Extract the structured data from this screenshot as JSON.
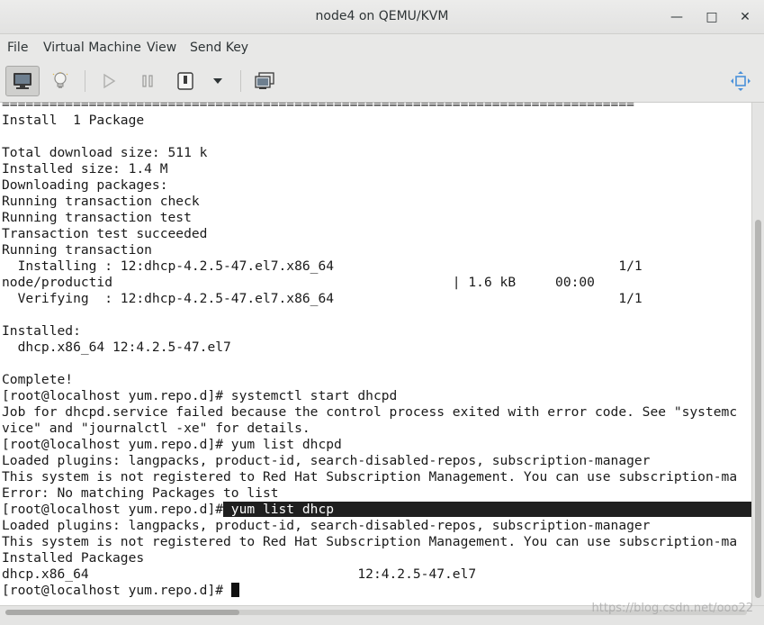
{
  "window": {
    "title": "node4 on QEMU/KVM",
    "minimize_glyph": "—",
    "maximize_glyph": "□",
    "close_glyph": "✕"
  },
  "menu": {
    "items": [
      "File",
      "Virtual Machine",
      "View",
      "Send Key"
    ]
  },
  "toolbar": {
    "buttons": [
      "console-view-icon",
      "details-lightbulb-icon",
      "run-play-icon",
      "pause-icon",
      "shutdown-power-icon",
      "shutdown-dropdown-chevron-icon",
      "snapshot-manager-icon",
      "fullscreen-resize-icon"
    ]
  },
  "console": {
    "lines": [
      "================================================================================",
      "Install  1 Package",
      "",
      "Total download size: 511 k",
      "Installed size: 1.4 M",
      "Downloading packages:",
      "Running transaction check",
      "Running transaction test",
      "Transaction test succeeded",
      "Running transaction",
      "  Installing : 12:dhcp-4.2.5-47.el7.x86_64                                    1/1",
      "node/productid                                           | 1.6 kB     00:00",
      "  Verifying  : 12:dhcp-4.2.5-47.el7.x86_64                                    1/1",
      "",
      "Installed:",
      "  dhcp.x86_64 12:4.2.5-47.el7",
      "",
      "Complete!",
      "[root@localhost yum.repo.d]# systemctl start dhcpd",
      "Job for dhcpd.service failed because the control process exited with error code. See \"systemc",
      "vice\" and \"journalctl -xe\" for details.",
      "[root@localhost yum.repo.d]# yum list dhcpd",
      "Loaded plugins: langpacks, product-id, search-disabled-repos, subscription-manager",
      "This system is not registered to Red Hat Subscription Management. You can use subscription-ma",
      "Error: No matching Packages to list"
    ],
    "highlight_prompt": "[root@localhost yum.repo.d]#",
    "highlight_command": " yum list dhcp",
    "lines_after": [
      "Loaded plugins: langpacks, product-id, search-disabled-repos, subscription-manager",
      "This system is not registered to Red Hat Subscription Management. You can use subscription-ma",
      "Installed Packages",
      "dhcp.x86_64                                  12:4.2.5-47.el7"
    ],
    "final_prompt": "[root@localhost yum.repo.d]# "
  },
  "watermark": "https://blog.csdn.net/ooo22",
  "colors": {
    "selection_bg": "#1f1f1f",
    "console_bg": "#ffffff"
  }
}
